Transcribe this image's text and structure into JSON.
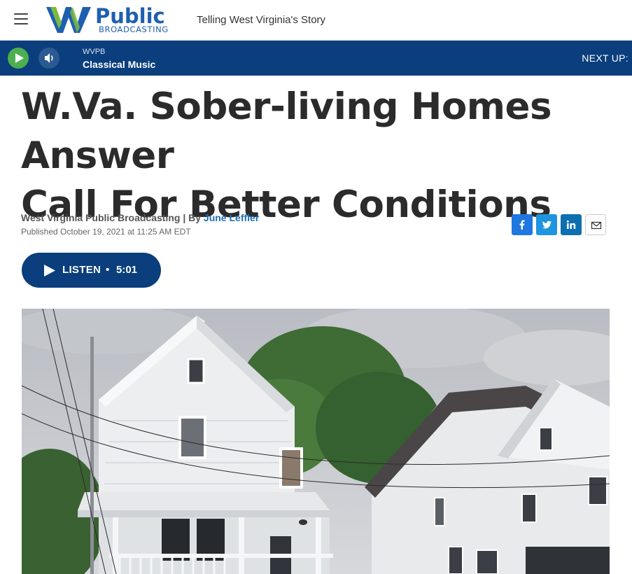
{
  "header": {
    "logo_word": "Public",
    "logo_subword": "BROADCASTING",
    "tagline": "Telling West Virginia's Story"
  },
  "player": {
    "station": "WVPB",
    "program": "Classical Music",
    "next_up": "NEXT UP:"
  },
  "article": {
    "headline_line1": "W.Va. Sober-living Homes Answer",
    "headline_line2": "Call For Better Conditions",
    "byline_org": "West Virginia Public Broadcasting | By ",
    "author": "June Leffler",
    "published": "Published October 19, 2021 at 11:25 AM EDT",
    "listen_label": "LISTEN",
    "listen_sep": "•",
    "listen_duration": "5:01"
  },
  "share": {
    "items": [
      "facebook-icon",
      "twitter-icon",
      "linkedin-icon",
      "email-icon"
    ]
  },
  "colors": {
    "brand_navy": "#0a3e7c",
    "play_green": "#4caf50",
    "link_blue": "#1d6fb8",
    "facebook": "#1f77e0",
    "twitter": "#1d95e0",
    "linkedin": "#0e6fb0"
  }
}
